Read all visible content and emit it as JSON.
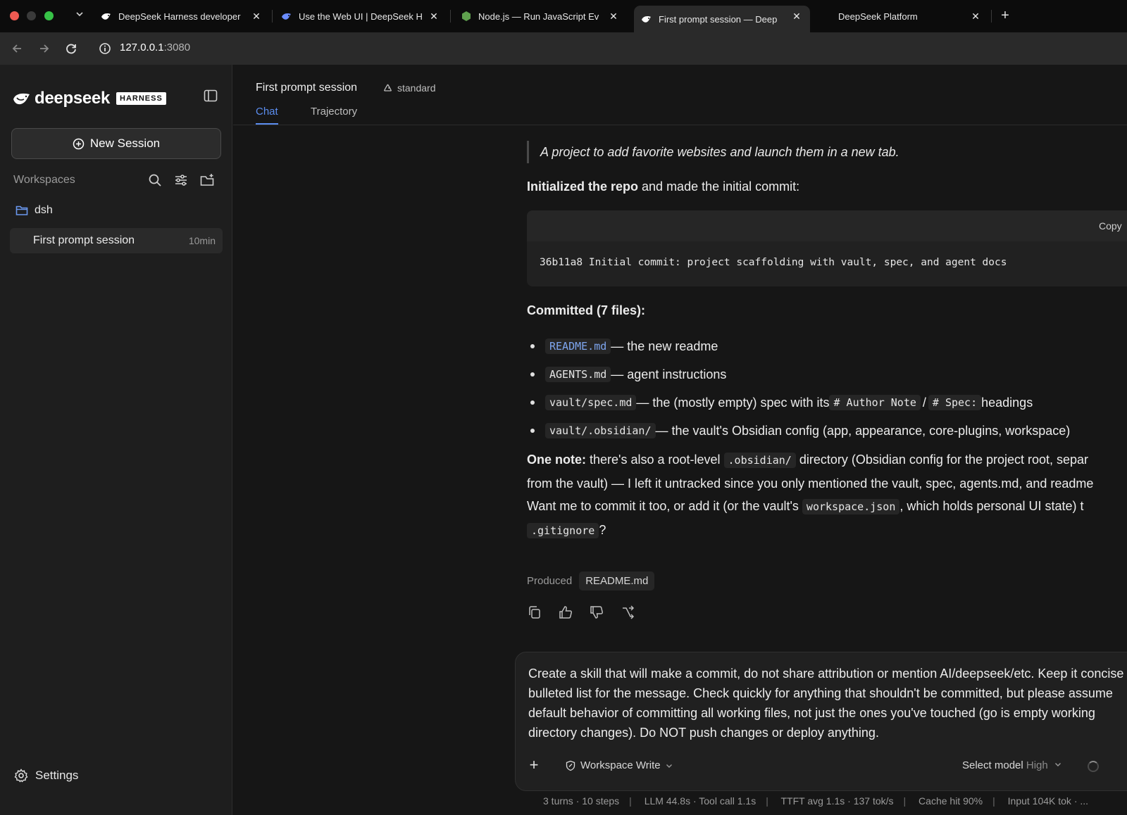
{
  "browser": {
    "tabs": [
      {
        "title": "DeepSeek Harness developer",
        "active": false
      },
      {
        "title": "Use the Web UI | DeepSeek H",
        "active": false
      },
      {
        "title": "Node.js — Run JavaScript Ev",
        "active": false
      },
      {
        "title": "First prompt session — Deep",
        "active": true
      },
      {
        "title": "DeepSeek Platform",
        "active": false
      }
    ],
    "url_host": "127.0.0.1",
    "url_port": ":3080"
  },
  "sidebar": {
    "logo_text": "deepseek",
    "logo_badge": "HARNESS",
    "new_session_label": "New Session",
    "workspaces_label": "Workspaces",
    "folder_name": "dsh",
    "session_name": "First prompt session",
    "session_time": "10min",
    "settings_label": "Settings"
  },
  "header": {
    "title": "First prompt session",
    "mode": "standard",
    "tabs": [
      "Chat",
      "Trajectory"
    ]
  },
  "message": {
    "quote": "A project to add favorite websites and launch them in a new tab.",
    "para1_bold": "Initialized the repo",
    "para1_rest": " and made the initial commit:",
    "copy_label": "Copy",
    "code": "36b11a8 Initial commit: project scaffolding with vault, spec, and agent docs",
    "committed_heading": "Committed (7 files):",
    "bullets": [
      {
        "code": "README.md",
        "text": " — the new readme"
      },
      {
        "code": "AGENTS.md",
        "text": " — agent instructions"
      },
      {
        "code": "vault/spec.md",
        "text": " — the (mostly empty) spec with its ",
        "code2": "# Author Note",
        "mid": "/",
        "code3": "# Spec:",
        "tail": " headings"
      },
      {
        "code": "vault/.obsidian/",
        "text": " — the vault's Obsidian config (app, appearance, core-plugins, workspace)"
      }
    ],
    "note_bold": "One note:",
    "note_l1a": " there's also a root-level ",
    "note_code1": ".obsidian/",
    "note_l1b": " directory (Obsidian config for the project root, separ",
    "note_l2": "from the vault) — I left it untracked since you only mentioned the vault, spec, agents.md, and readme",
    "note_l3a": "Want me to commit it too, or add it (or the vault's ",
    "note_code2": "workspace.json",
    "note_l3b": ", which holds personal UI state) t",
    "note_code3": ".gitignore",
    "note_l4": "?",
    "produced_label": "Produced",
    "produced_file": "README.md"
  },
  "composer": {
    "text": "Create a skill that will make a commit, do not share attribution or mention AI/deepseek/etc. Keep it concise bulleted list for the message. Check quickly for anything that shouldn't be committed, but please assume default behavior of committing all working files, not just the ones you've touched (go is empty working directory changes). Do NOT push changes or deploy anything.",
    "permission": "Workspace Write",
    "model_label": "Select model",
    "model_level": "High"
  },
  "status": [
    "3 turns · 10 steps",
    "LLM 44.8s · Tool call 1.1s",
    "TTFT avg 1.1s · 137 tok/s",
    "Cache hit 90%",
    "Input 104K tok · ..."
  ],
  "colors": {
    "accent": "#5b8def",
    "link_code": "#7ea6ef",
    "background": "#161616",
    "sidebar": "#1e1e1e"
  }
}
